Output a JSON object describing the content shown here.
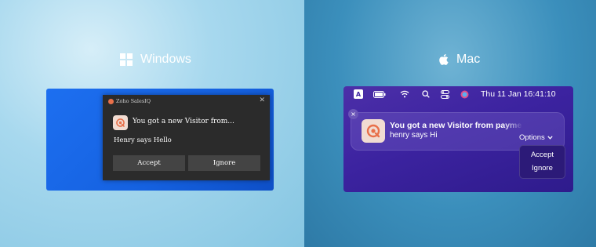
{
  "windows": {
    "heading": "Windows",
    "toast": {
      "app_name": "Zoho SalesIQ",
      "close_glyph": "✕",
      "title": "You got a new Visitor from...",
      "body": "Henry says Hello",
      "buttons": [
        "Accept",
        "Ignore"
      ]
    }
  },
  "mac": {
    "heading": "Mac",
    "menubar": {
      "input_source": "A",
      "datetime": "Thu 11 Jan  16:41:10"
    },
    "notification": {
      "close_glyph": "×",
      "title": "You got a new Visitor from payme",
      "body": "henry says Hi",
      "options_label": "Options",
      "menu_items": [
        "Accept",
        "Ignore"
      ]
    }
  },
  "colors": {
    "windows_card": "#1561e0",
    "mac_card": "#3c23a0",
    "brand_accent": "#e8704a"
  },
  "icons": {
    "windows_logo": "windows-logo-icon",
    "apple_logo": "apple-logo-icon",
    "app_logo": "salesiq-logo-icon"
  }
}
